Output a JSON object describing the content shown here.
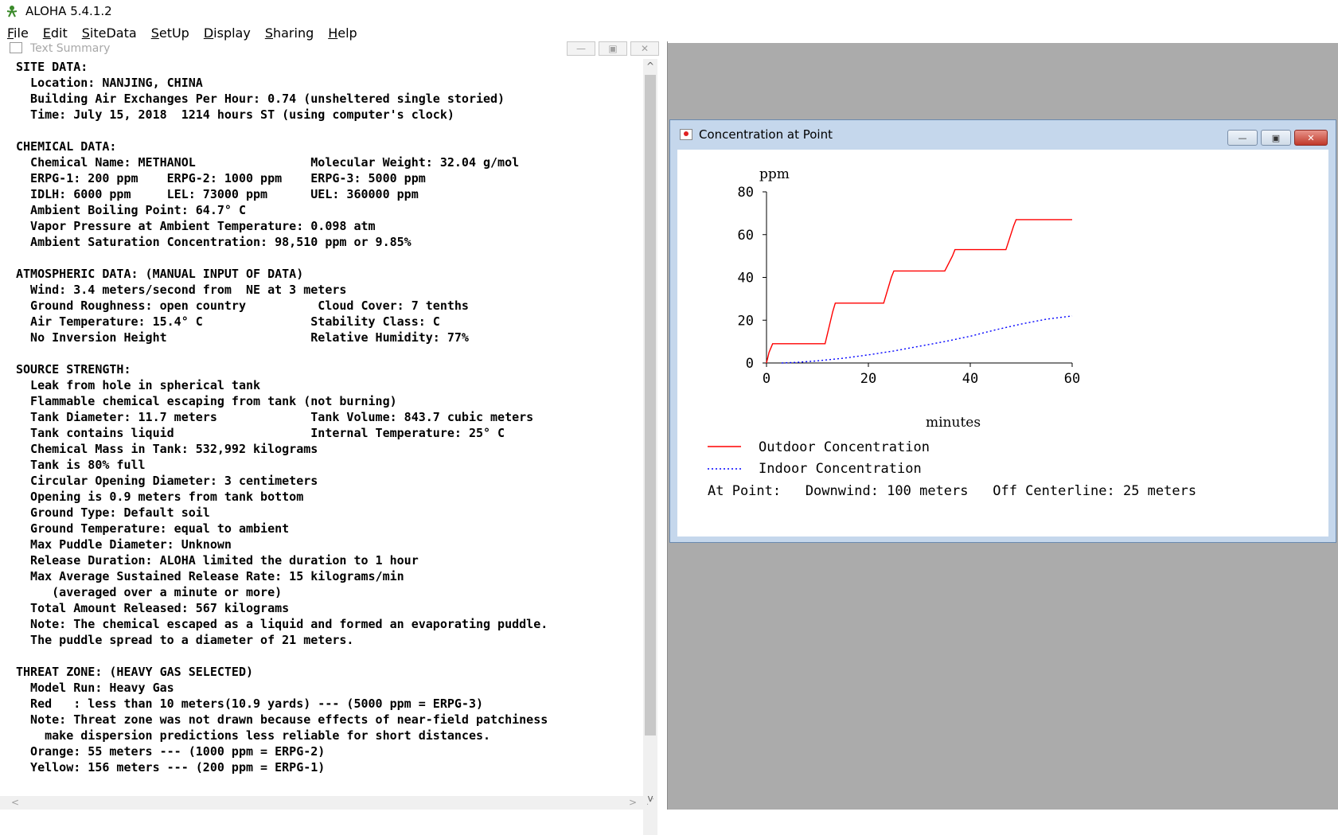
{
  "app": {
    "title": "ALOHA 5.4.1.2"
  },
  "menu": [
    {
      "label": "File",
      "u": "F",
      "rest": "ile"
    },
    {
      "label": "Edit",
      "u": "E",
      "rest": "dit"
    },
    {
      "label": "SiteData",
      "u": "S",
      "rest": "iteData"
    },
    {
      "label": "SetUp",
      "u": "S",
      "rest": "etUp"
    },
    {
      "label": "Display",
      "u": "D",
      "rest": "isplay"
    },
    {
      "label": "Sharing",
      "u": "S",
      "rest": "haring"
    },
    {
      "label": "Help",
      "u": "H",
      "rest": "elp"
    }
  ],
  "text_summary": {
    "title": "Text Summary",
    "lines": [
      "SITE DATA:",
      "  Location: NANJING, CHINA",
      "  Building Air Exchanges Per Hour: 0.74 (unsheltered single storied)",
      "  Time: July 15, 2018  1214 hours ST (using computer's clock)",
      "",
      "CHEMICAL DATA:",
      "  Chemical Name: METHANOL                Molecular Weight: 32.04 g/mol",
      "  ERPG-1: 200 ppm    ERPG-2: 1000 ppm    ERPG-3: 5000 ppm",
      "  IDLH: 6000 ppm     LEL: 73000 ppm      UEL: 360000 ppm",
      "  Ambient Boiling Point: 64.7° C",
      "  Vapor Pressure at Ambient Temperature: 0.098 atm",
      "  Ambient Saturation Concentration: 98,510 ppm or 9.85%",
      "",
      "ATMOSPHERIC DATA: (MANUAL INPUT OF DATA)",
      "  Wind: 3.4 meters/second from  NE at 3 meters",
      "  Ground Roughness: open country          Cloud Cover: 7 tenths",
      "  Air Temperature: 15.4° C               Stability Class: C",
      "  No Inversion Height                    Relative Humidity: 77%",
      "",
      "SOURCE STRENGTH:",
      "  Leak from hole in spherical tank",
      "  Flammable chemical escaping from tank (not burning)",
      "  Tank Diameter: 11.7 meters             Tank Volume: 843.7 cubic meters",
      "  Tank contains liquid                   Internal Temperature: 25° C",
      "  Chemical Mass in Tank: 532,992 kilograms",
      "  Tank is 80% full",
      "  Circular Opening Diameter: 3 centimeters",
      "  Opening is 0.9 meters from tank bottom",
      "  Ground Type: Default soil",
      "  Ground Temperature: equal to ambient",
      "  Max Puddle Diameter: Unknown",
      "  Release Duration: ALOHA limited the duration to 1 hour",
      "  Max Average Sustained Release Rate: 15 kilograms/min",
      "     (averaged over a minute or more)",
      "  Total Amount Released: 567 kilograms",
      "  Note: The chemical escaped as a liquid and formed an evaporating puddle.",
      "  The puddle spread to a diameter of 21 meters.",
      "",
      "THREAT ZONE: (HEAVY GAS SELECTED)",
      "  Model Run: Heavy Gas",
      "  Red   : less than 10 meters(10.9 yards) --- (5000 ppm = ERPG-3)",
      "  Note: Threat zone was not drawn because effects of near-field patchiness",
      "    make dispersion predictions less reliable for short distances.",
      "  Orange: 55 meters --- (1000 ppm = ERPG-2)",
      "  Yellow: 156 meters --- (200 ppm = ERPG-1)"
    ]
  },
  "concentration_window": {
    "title": "Concentration at Point",
    "legend": {
      "outdoor": "Outdoor Concentration",
      "indoor": "Indoor Concentration"
    },
    "at_point": "At Point:   Downwind: 100 meters   Off Centerline: 25 meters",
    "colors": {
      "outdoor": "#ff0000",
      "indoor": "#0000ff"
    }
  },
  "chart_data": {
    "type": "line",
    "ylabel": "ppm",
    "xlabel": "minutes",
    "xlim": [
      0,
      60
    ],
    "ylim": [
      0,
      80
    ],
    "x_ticks": [
      0,
      20,
      40,
      60
    ],
    "y_ticks": [
      0,
      20,
      40,
      60,
      80
    ],
    "series": [
      {
        "name": "Outdoor Concentration",
        "style": "solid",
        "color": "#ff0000",
        "points": [
          [
            0,
            0
          ],
          [
            0.5,
            5
          ],
          [
            1.2,
            9
          ],
          [
            11.5,
            9
          ],
          [
            13,
            24
          ],
          [
            13.5,
            28
          ],
          [
            23,
            28
          ],
          [
            24.5,
            40
          ],
          [
            25,
            43
          ],
          [
            35,
            43
          ],
          [
            36.5,
            50
          ],
          [
            37,
            53
          ],
          [
            47,
            53
          ],
          [
            48.5,
            64
          ],
          [
            49,
            67
          ],
          [
            60,
            67
          ]
        ]
      },
      {
        "name": "Indoor Concentration",
        "style": "dotted",
        "color": "#0000ff",
        "points": [
          [
            3,
            0
          ],
          [
            6,
            0.3
          ],
          [
            10,
            1
          ],
          [
            15,
            2.2
          ],
          [
            20,
            3.8
          ],
          [
            25,
            5.6
          ],
          [
            30,
            7.8
          ],
          [
            35,
            10
          ],
          [
            40,
            12.5
          ],
          [
            45,
            15.5
          ],
          [
            50,
            18.2
          ],
          [
            55,
            20.5
          ],
          [
            60,
            22
          ]
        ]
      }
    ]
  }
}
